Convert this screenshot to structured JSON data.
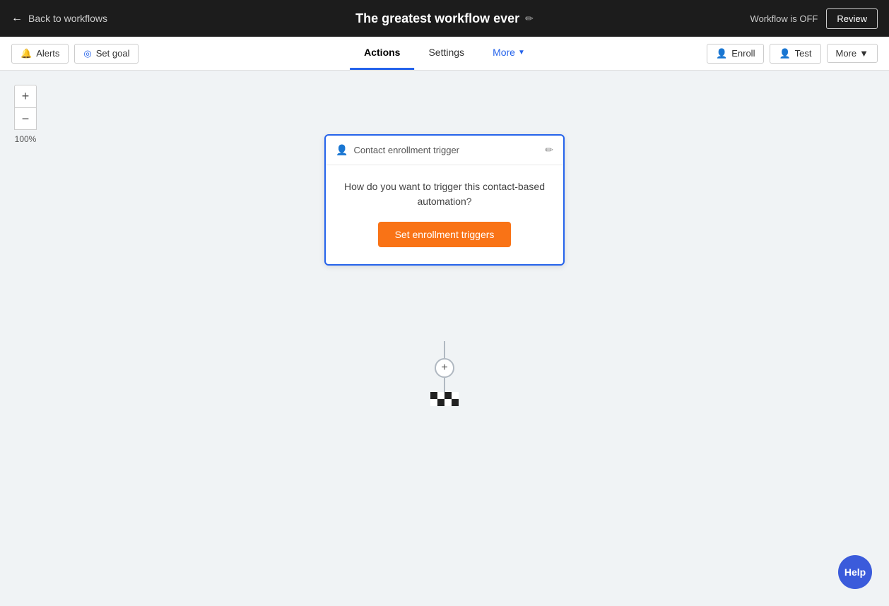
{
  "topNav": {
    "backLabel": "Back to workflows",
    "workflowTitle": "The greatest workflow ever",
    "editIconLabel": "✏",
    "workflowStatus": "Workflow is OFF",
    "reviewLabel": "Review"
  },
  "secondaryNav": {
    "alertsLabel": "Alerts",
    "setGoalLabel": "Set goal",
    "tabs": [
      {
        "id": "actions",
        "label": "Actions",
        "active": true
      },
      {
        "id": "settings",
        "label": "Settings",
        "active": false
      },
      {
        "id": "more",
        "label": "More",
        "active": false,
        "hasArrow": true,
        "isMore": true
      }
    ],
    "enrollLabel": "Enroll",
    "testLabel": "Test",
    "moreLabel": "More"
  },
  "canvas": {
    "zoomIn": "+",
    "zoomOut": "−",
    "zoomLevel": "100%"
  },
  "triggerCard": {
    "headerLabel": "Contact enrollment trigger",
    "bodyText": "How do you want to trigger this contact-based automation?",
    "triggerBtnLabel": "Set enrollment triggers"
  },
  "helpBtn": "Help",
  "endFlag": {
    "pattern": [
      "black",
      "white",
      "black",
      "white",
      "white",
      "black",
      "white",
      "black"
    ]
  }
}
